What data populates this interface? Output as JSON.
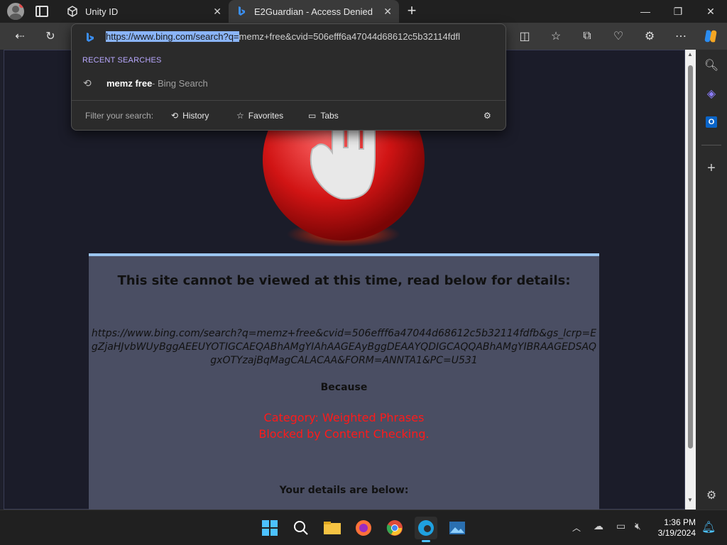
{
  "tabs": [
    {
      "label": "Unity ID",
      "active": false
    },
    {
      "label": "E2Guardian - Access Denied",
      "active": true
    }
  ],
  "address_bar": {
    "url_selected": "https://www.bing.com/search?q=",
    "url_rest": "memz+free&cvid=506efff6a47044d68612c5b32114fdfl"
  },
  "dropdown": {
    "recent_label": "RECENT SEARCHES",
    "recent_query": "memz free",
    "recent_source": "- Bing Search",
    "filter_label": "Filter your search:",
    "filters": [
      "History",
      "Favorites",
      "Tabs"
    ]
  },
  "page": {
    "heading": "This site cannot be viewed at this time, read below for details:",
    "blocked_url": "https://www.bing.com/search?q=memz+free&cvid=506efff6a47044d68612c5b32114fdfb&gs_lcrp=EgZjaHJvbWUyBggAEEUYOTIGCAEQABhAMgYIAhAAGEAyBggDEAAYQDIGCAQQABhAMgYIBRAAGEDSAQgxOTYzajBqMagCALACAA&FORM=ANNTA1&PC=U531",
    "because": "Because",
    "reason_category": "Category: Weighted Phrases",
    "reason_detail": "Blocked by Content Checking.",
    "details_label": "Your details are below:"
  },
  "clock": {
    "time": "1:36 PM",
    "date": "3/19/2024"
  },
  "colors": {
    "accent": "#9bc5ef",
    "error_red": "#ff1a1a",
    "panel_bg": "#4a4e63"
  }
}
